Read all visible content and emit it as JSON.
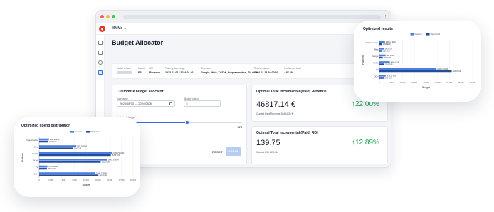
{
  "app": {
    "name": "MMMs",
    "page_title": "Budget Allocator"
  },
  "info": [
    {
      "label": "Model version",
      "value": ""
    },
    {
      "label": "Market",
      "value": "ES"
    },
    {
      "label": "KPI",
      "value": "Revenue"
    },
    {
      "label": "Training date range",
      "value": "2023-01-01 / 2024-01-01"
    },
    {
      "label": "Channels",
      "value": "Google, Meta, TikTok, Programmatics, TV, OOH"
    },
    {
      "label": "Refresh status",
      "value": "2024-02-14 10:00:03"
    },
    {
      "label": "Confidence level",
      "value": "87.6%"
    }
  ],
  "customize": {
    "title": "Customize budget allocator",
    "date_label": "Date range",
    "date_value": "2023/08/30 — 2024/08/30",
    "budget_label": "Budget option",
    "budget_value": "0",
    "change_label": "% Budget change",
    "change_value": "30%",
    "change_fraction": 0.56,
    "reset_label": "RESET",
    "apply_label": "APPLY"
  },
  "revenue": {
    "title": "Optimal Total Incremental (Paid) Revenue",
    "value": "46817.14 €",
    "delta": "22.00%",
    "current": "Current Paid Revenue 38464.30 €"
  },
  "roi": {
    "title": "Optimal Total Incremental (Paid) ROI",
    "value": "139.75",
    "delta": "12.89%",
    "current": "Current ROI 124.86"
  },
  "colors": {
    "current": "#4a7fe0",
    "optimized": "#274b9b",
    "accent": "#2f6fe0",
    "positive": "#22a35a"
  },
  "charts": [
    {
      "title": "Optimized spend distribution",
      "chart_data": {
        "type": "bar",
        "orientation": "horizontal",
        "categories": [
          "Programmatics",
          "Meta",
          "Google",
          "TikTok",
          "TV",
          "OOH"
        ],
        "series": [
          {
            "name": "Current",
            "values": [
              2080.43,
              7898.24,
              15640.59,
              14507.37,
              1750.29,
              11986.23
            ],
            "labels": [
              "2080.43 EUR",
              "7898.24 EUR",
              "15640.59 EUR",
              "14507.37 EUR",
              "1750.29 EUR",
              "11986.23 EUR"
            ]
          },
          {
            "name": "Optimized",
            "values": [
              1950,
              7200,
              15250,
              13100,
              1650,
              12450
            ],
            "labels": [
              "1950 EUR",
              "7200 EUR",
              "15250 EUR",
              "13100 EUR",
              "1650 EUR",
              "12450 EUR"
            ]
          }
        ],
        "xlabel": "Budget",
        "ylabel": "Platform",
        "xlim": [
          0,
          20000
        ],
        "xticks": [
          "0",
          "2,500",
          "5,000",
          "7,500",
          "10,000",
          "12,500",
          "15,000",
          "17,500",
          "20,000"
        ],
        "legend": "top-center"
      }
    },
    {
      "title": "Optimized results",
      "chart_data": {
        "type": "bar",
        "orientation": "horizontal",
        "categories": [
          "Programmatics",
          "Meta",
          "Google",
          "TikTok",
          "TV",
          "OOH"
        ],
        "series": [
          {
            "name": "Current",
            "values": [
              2386,
              1963,
              2627,
              4466,
              24492,
              2678
            ],
            "labels": [
              "2386.05 EUR",
              "1963 EUR",
              "2627 EUR",
              "4466.4 EUR",
              "24492.35 EUR",
              "2678.31 EUR"
            ]
          },
          {
            "name": "Optimized",
            "values": [
              1250,
              1025,
              1400,
              2100,
              31000,
              1900
            ],
            "labels": [
              "1250 EUR",
              "1025 EUR",
              "1400 EUR",
              "2100 EUR",
              "31000 EUR",
              "1900 EUR"
            ]
          }
        ],
        "xlabel": "Budget",
        "ylabel": "Platform",
        "xlim": [
          0,
          40000
        ],
        "xticks": [
          "0",
          "5,000",
          "10,000",
          "15,000",
          "20,000",
          "25,000",
          "30,000",
          "35,000",
          "40,000"
        ],
        "legend": "top-center"
      }
    }
  ]
}
